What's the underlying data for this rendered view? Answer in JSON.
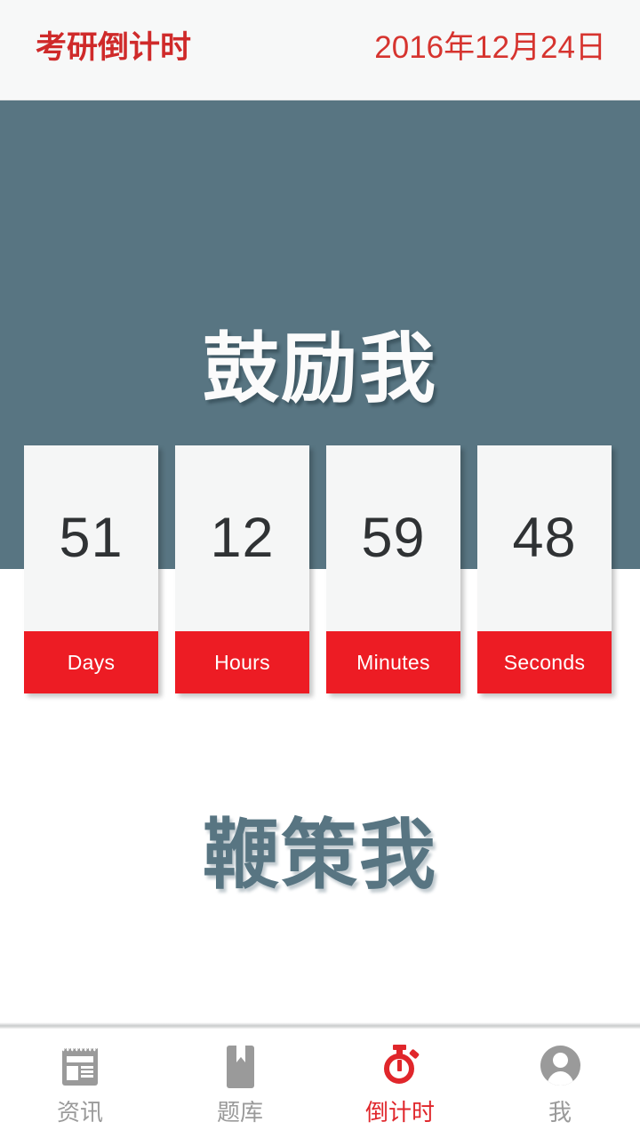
{
  "header": {
    "title": "考研倒计时",
    "date": "2016年12月24日",
    "title_color": "#cf2a2a",
    "date_color": "#d6342f",
    "background": "#f7f8f8"
  },
  "hero": {
    "encourage_text": "鼓励我",
    "background": "#587582",
    "text_color": "#fbfbfb"
  },
  "countdown": {
    "items": [
      {
        "value": "51",
        "label": "Days"
      },
      {
        "value": "12",
        "label": "Hours"
      },
      {
        "value": "59",
        "label": "Minutes"
      },
      {
        "value": "48",
        "label": "Seconds"
      }
    ],
    "card_background": "#f5f6f6",
    "label_background": "#ed1c24",
    "value_color": "#2f3234"
  },
  "lower": {
    "motivate_text": "鞭策我",
    "text_color": "#587582"
  },
  "tabbar": {
    "items": [
      {
        "label": "资讯",
        "icon": "news-icon",
        "active": false
      },
      {
        "label": "题库",
        "icon": "book-icon",
        "active": false
      },
      {
        "label": "倒计时",
        "icon": "stopwatch-icon",
        "active": true
      },
      {
        "label": "我",
        "icon": "person-icon",
        "active": false
      }
    ],
    "inactive_color": "#9a9a9a",
    "active_color": "#e0262b"
  }
}
